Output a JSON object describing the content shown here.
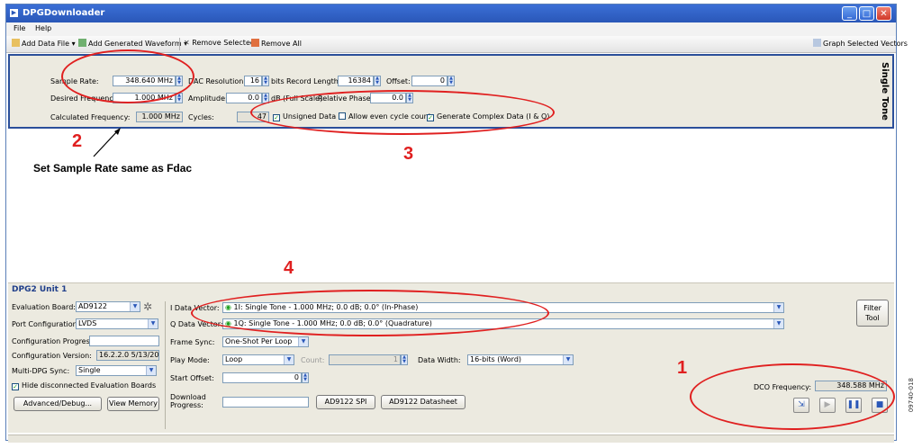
{
  "window": {
    "title": "DPGDownloader"
  },
  "menu": {
    "file": "File",
    "help": "Help"
  },
  "toolbar": {
    "add_data_file": "Add Data File",
    "add_generated_waveform": "Add Generated Waveform",
    "remove_selected": "Remove Selected",
    "remove_all": "Remove All",
    "graph_selected_vectors": "Graph Selected Vectors"
  },
  "tone_panel": {
    "tab_label": "Single Tone",
    "sample_rate_label": "Sample Rate:",
    "sample_rate_value": "348.640 MHz",
    "desired_freq_label": "Desired Frequency:",
    "desired_freq_value": "1.000 MHz",
    "calc_freq_label": "Calculated Frequency:",
    "calc_freq_value": "1.000 MHz",
    "dac_res_label": "DAC Resolution:",
    "dac_res_value": "16",
    "dac_res_unit": "bits",
    "amplitude_label": "Amplitude:",
    "amplitude_value": "0.0",
    "amplitude_unit": "dB (Full Scale)",
    "cycles_label": "Cycles:",
    "cycles_value": "47",
    "record_length_label": "Record Length:",
    "record_length_value": "16384",
    "offset_label": "Offset:",
    "offset_value": "0",
    "relative_phase_label": "Relative Phase:",
    "relative_phase_value": "0.0",
    "unsigned_data": "Unsigned Data",
    "allow_even_cycle": "Allow even cycle count",
    "generate_complex": "Generate Complex Data (I & Q)"
  },
  "unit": {
    "title": "DPG2 Unit 1",
    "eval_board_label": "Evaluation Board:",
    "eval_board_value": "AD9122",
    "port_config_label": "Port Configuration:",
    "port_config_value": "LVDS",
    "config_progress_label": "Configuration Progress:",
    "config_version_label": "Configuration Version:",
    "config_version_value": "16.2.2.0 5/13/2010",
    "multi_dpg_label": "Multi-DPG Sync:",
    "multi_dpg_value": "Single",
    "hide_disconnected": "Hide disconnected Evaluation Boards",
    "advanced_button": "Advanced/Debug...",
    "view_memory_button": "View Memory",
    "i_data_label": "I Data Vector:",
    "i_data_value": "1I: Single Tone - 1.000 MHz; 0.0 dB; 0.0° (In-Phase)",
    "q_data_label": "Q Data Vector:",
    "q_data_value": "1Q: Single Tone - 1.000 MHz; 0.0 dB; 0.0° (Quadrature)",
    "frame_sync_label": "Frame Sync:",
    "frame_sync_value": "One-Shot Per Loop",
    "play_mode_label": "Play Mode:",
    "play_mode_value": "Loop",
    "count_label": "Count:",
    "count_value": "1",
    "start_offset_label": "Start Offset:",
    "start_offset_value": "0",
    "data_width_label": "Data Width:",
    "data_width_value": "16-bits (Word)",
    "download_progress_label_1": "Download",
    "download_progress_label_2": "Progress:",
    "spi_button": "AD9122 SPI",
    "datasheet_button": "AD9122 Datasheet",
    "filter_tool_1": "Filter",
    "filter_tool_2": "Tool",
    "dco_label": "DCO Frequency:",
    "dco_value": "348.588 MHz"
  },
  "annotations": {
    "n1": "1",
    "n2": "2",
    "n3": "3",
    "n4": "4",
    "note": "Set Sample Rate same as Fdac",
    "figure_id": "09740-018"
  },
  "colors": {
    "title_bar": "#2a57b8",
    "annotation": "#e02020",
    "panel": "#eceae0"
  }
}
